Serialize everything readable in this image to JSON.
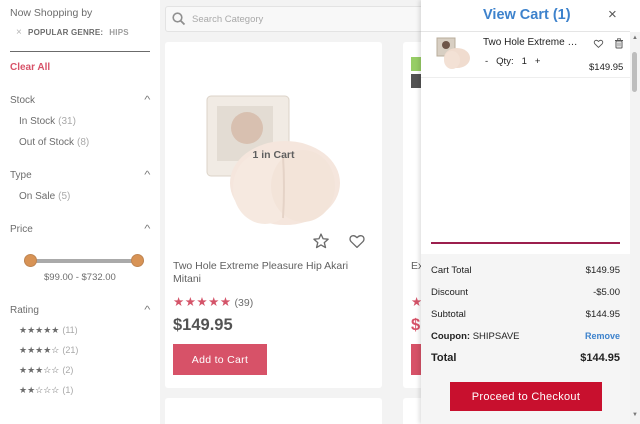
{
  "sidebar": {
    "now_shopping": "Now Shopping by",
    "chip_prefix": "×",
    "chip_label": "POPULAR GENRE:",
    "chip_value": "HIPS",
    "clear_all": "Clear All",
    "stock": {
      "title": "Stock",
      "options": [
        {
          "label": "In Stock",
          "count": "(31)"
        },
        {
          "label": "Out of Stock",
          "count": "(8)"
        }
      ]
    },
    "type": {
      "title": "Type",
      "options": [
        {
          "label": "On Sale",
          "count": "(5)"
        }
      ]
    },
    "price": {
      "title": "Price",
      "range": "$99.00 - $732.00",
      "min_fraction": 0.0,
      "max_fraction": 1.0
    },
    "rating": {
      "title": "Rating",
      "rows": [
        {
          "stars": "★★★★★",
          "count": "(11)"
        },
        {
          "stars": "★★★★☆",
          "count": "(21)"
        },
        {
          "stars": "★★★☆☆",
          "count": "(2)"
        },
        {
          "stars": "★★☆☆☆",
          "count": "(1)"
        }
      ]
    }
  },
  "search": {
    "placeholder": "Search Category"
  },
  "product": {
    "in_cart": "1 in Cart",
    "name": "Two Hole Extreme Pleasure Hip Akari Mitani",
    "stars": "★★★★★",
    "review_count": "(39)",
    "price": "$149.95",
    "add_to_cart": "Add to Cart"
  },
  "product2": {
    "name_fragment": "Ex",
    "stars_fragment": "★",
    "price_fragment": "$1"
  },
  "promo": {
    "letter": "S"
  },
  "cart": {
    "title": "View Cart (1)",
    "close": "×",
    "item": {
      "name": "Two Hole Extreme Pleasure Hip Akari Mitani",
      "minus": "-",
      "qty_label": "Qty:",
      "qty": "1",
      "plus": "+",
      "price": "$149.95"
    },
    "totals": {
      "cart_total_label": "Cart Total",
      "cart_total": "$149.95",
      "discount_label": "Discount",
      "discount": "-$5.00",
      "subtotal_label": "Subtotal",
      "subtotal": "$144.95",
      "coupon_label": "Coupon:",
      "coupon_code": "SHIPSAVE",
      "remove": "Remove",
      "total_label": "Total",
      "total": "$144.95"
    },
    "checkout": "Proceed to Checkout"
  },
  "colors": {
    "brand_red": "#c8102e",
    "link_blue": "#3d82cc",
    "slider_knob": "#c96a14",
    "accent_line": "#9c1f4e"
  }
}
